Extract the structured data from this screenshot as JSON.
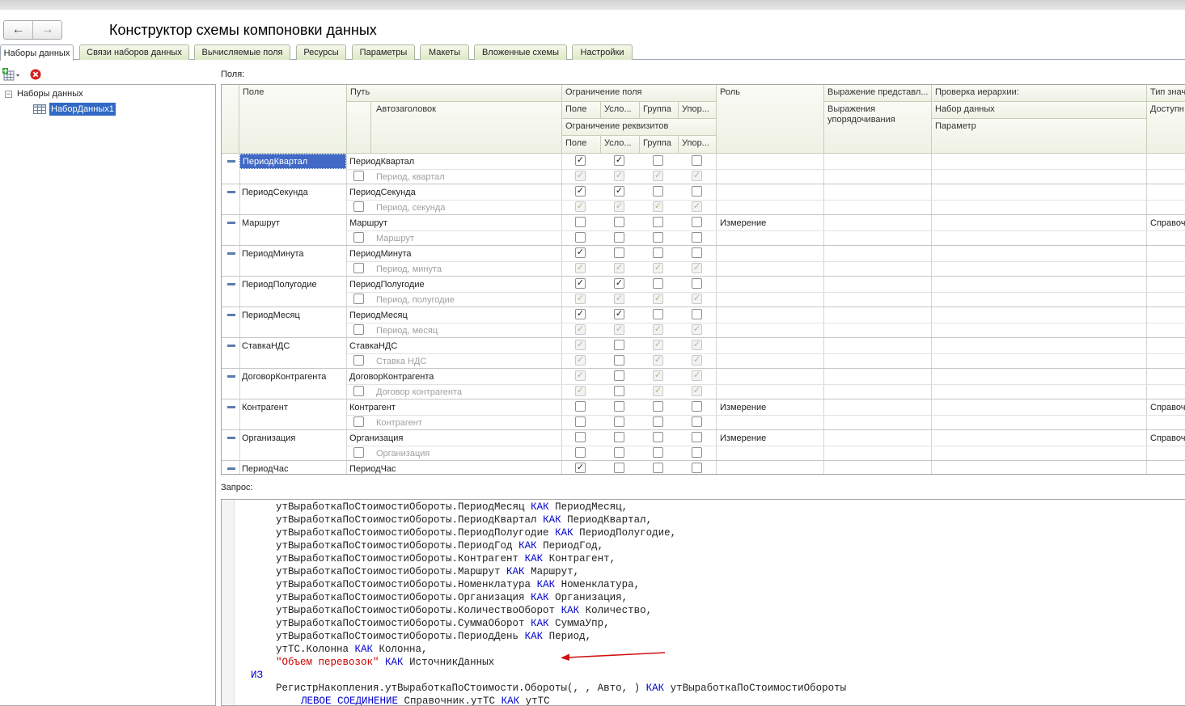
{
  "window": {
    "title": "Конструктор схемы компоновки данных",
    "back": "←",
    "forward": "→"
  },
  "tabs": [
    "Наборы данных",
    "Связи наборов данных",
    "Вычисляемые поля",
    "Ресурсы",
    "Параметры",
    "Макеты",
    "Вложенные схемы",
    "Настройки"
  ],
  "tree": {
    "root": "Наборы данных",
    "child": "НаборДанных1"
  },
  "fields_label": "Поля:",
  "headers": {
    "field": "Поле",
    "path": "Путь",
    "autotitle": "Автозаголовок",
    "restriction": "Ограничение поля",
    "pole": "Поле",
    "uslo": "Усло...",
    "gruppa": "Группа",
    "upor": "Упор...",
    "attr_restriction": "Ограничение реквизитов",
    "role": "Роль",
    "expr": "Выражение представл...",
    "expr_order": "Выражения упорядочивания",
    "hier": "Проверка иерархии:",
    "hier_set": "Набор данных",
    "hier_param": "Параметр",
    "type": "Тип знач",
    "avail": "Доступн"
  },
  "rows": [
    {
      "field": "ПериодКвартал",
      "path": "ПериодКвартал",
      "title": "Период, квартал",
      "role": "",
      "type": "",
      "r1": [
        1,
        1,
        0,
        0
      ],
      "d1": [
        0,
        0,
        0,
        0
      ],
      "r2": [
        1,
        1,
        1,
        1
      ],
      "d2": [
        1,
        1,
        1,
        1
      ],
      "sel": true
    },
    {
      "field": "ПериодСекунда",
      "path": "ПериодСекунда",
      "title": "Период, секунда",
      "role": "",
      "type": "",
      "r1": [
        1,
        1,
        0,
        0
      ],
      "d1": [
        0,
        0,
        0,
        0
      ],
      "r2": [
        1,
        1,
        1,
        1
      ],
      "d2": [
        1,
        1,
        1,
        1
      ]
    },
    {
      "field": "Маршрут",
      "path": "Маршрут",
      "title": "Маршрут",
      "role": "Измерение",
      "type": "Справоч",
      "r1": [
        0,
        0,
        0,
        0
      ],
      "d1": [
        0,
        0,
        0,
        0
      ],
      "r2": [
        0,
        0,
        0,
        0
      ],
      "d2": [
        0,
        0,
        0,
        0
      ]
    },
    {
      "field": "ПериодМинута",
      "path": "ПериодМинута",
      "title": "Период, минута",
      "role": "",
      "type": "",
      "r1": [
        1,
        0,
        0,
        0
      ],
      "d1": [
        0,
        0,
        0,
        0
      ],
      "r2": [
        1,
        1,
        1,
        1
      ],
      "d2": [
        1,
        1,
        1,
        1
      ]
    },
    {
      "field": "ПериодПолугодие",
      "path": "ПериодПолугодие",
      "title": "Период, полугодие",
      "role": "",
      "type": "",
      "r1": [
        1,
        1,
        0,
        0
      ],
      "d1": [
        0,
        0,
        0,
        0
      ],
      "r2": [
        1,
        1,
        1,
        1
      ],
      "d2": [
        1,
        1,
        1,
        1
      ]
    },
    {
      "field": "ПериодМесяц",
      "path": "ПериодМесяц",
      "title": "Период, месяц",
      "role": "",
      "type": "",
      "r1": [
        1,
        1,
        0,
        0
      ],
      "d1": [
        0,
        0,
        0,
        0
      ],
      "r2": [
        1,
        1,
        1,
        1
      ],
      "d2": [
        1,
        1,
        1,
        1
      ]
    },
    {
      "field": "СтавкаНДС",
      "path": "СтавкаНДС",
      "title": "Ставка НДС",
      "role": "",
      "type": "",
      "r1": [
        1,
        0,
        1,
        1
      ],
      "d1": [
        1,
        0,
        1,
        1
      ],
      "r2": [
        1,
        0,
        1,
        1
      ],
      "d2": [
        1,
        0,
        1,
        1
      ]
    },
    {
      "field": "ДоговорКонтрагента",
      "path": "ДоговорКонтрагента",
      "title": "Договор контрагента",
      "role": "",
      "type": "",
      "r1": [
        1,
        0,
        1,
        1
      ],
      "d1": [
        1,
        0,
        1,
        1
      ],
      "r2": [
        1,
        0,
        1,
        1
      ],
      "d2": [
        1,
        0,
        1,
        1
      ]
    },
    {
      "field": "Контрагент",
      "path": "Контрагент",
      "title": "Контрагент",
      "role": "Измерение",
      "type": "Справоч",
      "r1": [
        0,
        0,
        0,
        0
      ],
      "d1": [
        0,
        0,
        0,
        0
      ],
      "r2": [
        0,
        0,
        0,
        0
      ],
      "d2": [
        0,
        0,
        0,
        0
      ]
    },
    {
      "field": "Организация",
      "path": "Организация",
      "title": "Организация",
      "role": "Измерение",
      "type": "Справоч",
      "r1": [
        0,
        0,
        0,
        0
      ],
      "d1": [
        0,
        0,
        0,
        0
      ],
      "r2": [
        0,
        0,
        0,
        0
      ],
      "d2": [
        0,
        0,
        0,
        0
      ]
    },
    {
      "field": "ПериодЧас",
      "path": "ПериодЧас",
      "title": "",
      "role": "",
      "type": "",
      "r1": [
        1,
        0,
        0,
        0
      ],
      "d1": [
        0,
        0,
        0,
        0
      ],
      "r2": [
        0,
        0,
        0,
        0
      ],
      "d2": [
        0,
        0,
        0,
        0
      ]
    }
  ],
  "query_label": "Запрос:",
  "query": [
    {
      "i": 2,
      "parts": [
        [
          "утВыработкаПоСтоимостиОбороты.ПериодМесяц ",
          ""
        ],
        [
          "КАК",
          "kw"
        ],
        [
          " ПериодМесяц,",
          ""
        ]
      ]
    },
    {
      "i": 2,
      "parts": [
        [
          "утВыработкаПоСтоимостиОбороты.ПериодКвартал ",
          ""
        ],
        [
          "КАК",
          "kw"
        ],
        [
          " ПериодКвартал,",
          ""
        ]
      ]
    },
    {
      "i": 2,
      "parts": [
        [
          "утВыработкаПоСтоимостиОбороты.ПериодПолугодие ",
          ""
        ],
        [
          "КАК",
          "kw"
        ],
        [
          " ПериодПолугодие,",
          ""
        ]
      ]
    },
    {
      "i": 2,
      "parts": [
        [
          "утВыработкаПоСтоимостиОбороты.ПериодГод ",
          ""
        ],
        [
          "КАК",
          "kw"
        ],
        [
          " ПериодГод,",
          ""
        ]
      ]
    },
    {
      "i": 2,
      "parts": [
        [
          "утВыработкаПоСтоимостиОбороты.Контрагент ",
          ""
        ],
        [
          "КАК",
          "kw"
        ],
        [
          " Контрагент,",
          ""
        ]
      ]
    },
    {
      "i": 2,
      "parts": [
        [
          "утВыработкаПоСтоимостиОбороты.Маршрут ",
          ""
        ],
        [
          "КАК",
          "kw"
        ],
        [
          " Маршрут,",
          ""
        ]
      ]
    },
    {
      "i": 2,
      "parts": [
        [
          "утВыработкаПоСтоимостиОбороты.Номенклатура ",
          ""
        ],
        [
          "КАК",
          "kw"
        ],
        [
          " Номенклатура,",
          ""
        ]
      ]
    },
    {
      "i": 2,
      "parts": [
        [
          "утВыработкаПоСтоимостиОбороты.Организация ",
          ""
        ],
        [
          "КАК",
          "kw"
        ],
        [
          " Организация,",
          ""
        ]
      ]
    },
    {
      "i": 2,
      "parts": [
        [
          "утВыработкаПоСтоимостиОбороты.КоличествоОборот ",
          ""
        ],
        [
          "КАК",
          "kw"
        ],
        [
          " Количество,",
          ""
        ]
      ]
    },
    {
      "i": 2,
      "parts": [
        [
          "утВыработкаПоСтоимостиОбороты.СуммаОборот ",
          ""
        ],
        [
          "КАК",
          "kw"
        ],
        [
          " СуммаУпр,",
          ""
        ]
      ]
    },
    {
      "i": 2,
      "parts": [
        [
          "утВыработкаПоСтоимостиОбороты.ПериодДень ",
          ""
        ],
        [
          "КАК",
          "kw"
        ],
        [
          " Период,",
          ""
        ]
      ]
    },
    {
      "i": 2,
      "parts": [
        [
          "утТС.Колонна ",
          ""
        ],
        [
          "КАК",
          "kw"
        ],
        [
          " Колонна,",
          ""
        ]
      ]
    },
    {
      "i": 2,
      "parts": [
        [
          "\"Объем перевозок\"",
          "str"
        ],
        [
          " ",
          ""
        ],
        [
          "КАК",
          "kw"
        ],
        [
          " ИсточникДанных",
          ""
        ]
      ]
    },
    {
      "i": 1,
      "parts": [
        [
          "ИЗ",
          "kw"
        ]
      ]
    },
    {
      "i": 2,
      "parts": [
        [
          "РегистрНакопления.утВыработкаПоСтоимости.Обороты(, , Авто, ) ",
          ""
        ],
        [
          "КАК",
          "kw"
        ],
        [
          " утВыработкаПоСтоимостиОбороты",
          ""
        ]
      ]
    },
    {
      "i": 3,
      "parts": [
        [
          "ЛЕВОЕ СОЕДИНЕНИЕ",
          "kw"
        ],
        [
          " Справочник.утТС ",
          ""
        ],
        [
          "КАК",
          "kw"
        ],
        [
          " утТС",
          ""
        ]
      ]
    }
  ]
}
